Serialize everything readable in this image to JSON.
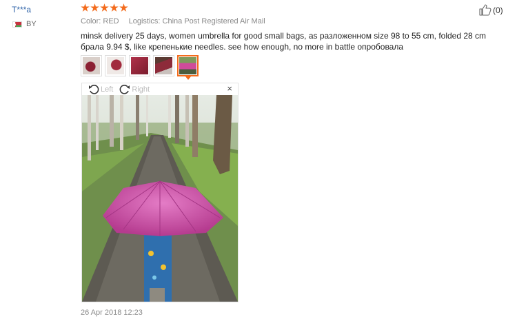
{
  "reviewer": {
    "name": "T***a",
    "country_code": "BY"
  },
  "rating": {
    "stars": 5,
    "max": 5
  },
  "helpful": {
    "count_label": "(0)"
  },
  "meta": {
    "color": "Color: RED",
    "logistics": "Logistics: China Post Registered Air Mail"
  },
  "review_text": "minsk delivery 25 days, women umbrella for good small bags, as разложенном size 98 to 55 cm, folded 28 cm брала 9.94 $, like крепенькие needles. see how enough, no more in battle опробовала",
  "viewer": {
    "rotate_left": "Left",
    "rotate_right": "Right",
    "close": "×",
    "selected_index": 4,
    "thumbnail_count": 5
  },
  "date": "26 Apr 2018 12:23",
  "colors": {
    "accent": "#f36b1c",
    "link": "#2f63a8"
  }
}
